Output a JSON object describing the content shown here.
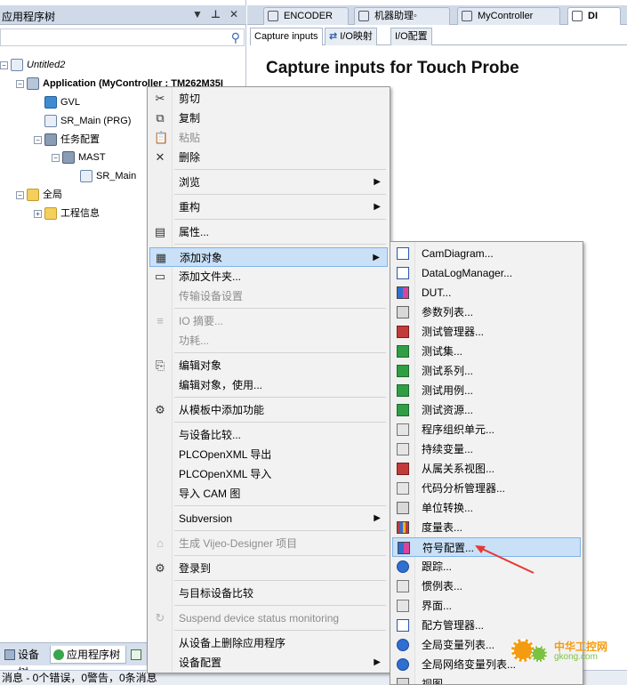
{
  "left_panel": {
    "title": "应用程序树",
    "controls": [
      "▼",
      "⊥",
      "✕"
    ],
    "tree": [
      {
        "label": "Untitled2",
        "level": 0,
        "icon": "document-icon",
        "expander": "−"
      },
      {
        "label": "Application (MyController : TM262M35I",
        "level": 1,
        "icon": "gear-icon",
        "expander": "−",
        "bold": true
      },
      {
        "label": "GVL",
        "level": 2,
        "icon": "globe-icon",
        "expander": ""
      },
      {
        "label": "SR_Main (PRG)",
        "level": 2,
        "icon": "program-icon",
        "expander": ""
      },
      {
        "label": "任务配置",
        "level": 2,
        "icon": "task-config-icon",
        "expander": "−"
      },
      {
        "label": "MAST",
        "level": 3,
        "icon": "task-icon",
        "expander": "−"
      },
      {
        "label": "SR_Main",
        "level": 4,
        "icon": "program-icon",
        "expander": ""
      },
      {
        "label": "全局",
        "level": 1,
        "icon": "folder-icon",
        "expander": "−"
      },
      {
        "label": "工程信息",
        "level": 2,
        "icon": "folder-icon",
        "expander": "+"
      }
    ],
    "bottom_tabs": [
      "设备树",
      "应用程序树"
    ]
  },
  "status": {
    "text": "消息 - 0个错误，0警告，0条消息"
  },
  "doc_tabs": [
    {
      "label": "ENCODER",
      "active": false
    },
    {
      "label": "机器助理◦",
      "active": false
    },
    {
      "label": "MyController",
      "active": false
    },
    {
      "label": "DI",
      "active": true
    }
  ],
  "sub_tabs": [
    {
      "label": "Capture inputs",
      "active": true
    },
    {
      "label": "I/O映射",
      "active": false
    },
    {
      "label": "I/O配置",
      "active": false
    }
  ],
  "page_heading": "Capture inputs for Touch Probe",
  "context_menu": {
    "items": [
      {
        "label": "剪切",
        "icon": "✂",
        "disabled": false,
        "submenu": false
      },
      {
        "label": "复制",
        "icon": "⧉",
        "disabled": false,
        "submenu": false
      },
      {
        "label": "粘贴",
        "icon": "📋",
        "disabled": true,
        "submenu": false
      },
      {
        "label": "删除",
        "icon": "✕",
        "disabled": false,
        "submenu": false
      },
      {
        "sep": true
      },
      {
        "label": "浏览",
        "icon": "",
        "disabled": false,
        "submenu": true
      },
      {
        "sep": true
      },
      {
        "label": "重构",
        "icon": "",
        "disabled": false,
        "submenu": true
      },
      {
        "sep": true
      },
      {
        "label": "属性...",
        "icon": "▤",
        "disabled": false,
        "submenu": false
      },
      {
        "sep": true
      },
      {
        "label": "添加对象",
        "icon": "▦",
        "disabled": false,
        "submenu": true,
        "highlight": true
      },
      {
        "label": "添加文件夹...",
        "icon": "▭",
        "disabled": false,
        "submenu": false
      },
      {
        "label": "传输设备设置",
        "icon": "",
        "disabled": true,
        "submenu": false
      },
      {
        "sep": true
      },
      {
        "label": "IO 摘要...",
        "icon": "≡",
        "disabled": true,
        "submenu": false
      },
      {
        "label": "功耗...",
        "icon": "",
        "disabled": true,
        "submenu": false
      },
      {
        "sep": true
      },
      {
        "label": "编辑对象",
        "icon": "⎘",
        "disabled": false,
        "submenu": false
      },
      {
        "label": "编辑对象，使用...",
        "icon": "",
        "disabled": false,
        "submenu": false
      },
      {
        "sep": true
      },
      {
        "label": "从模板中添加功能",
        "icon": "⚙",
        "disabled": false,
        "submenu": false
      },
      {
        "sep": true
      },
      {
        "label": "与设备比较...",
        "icon": "",
        "disabled": false,
        "submenu": false
      },
      {
        "label": "PLCOpenXML 导出",
        "icon": "",
        "disabled": false,
        "submenu": false
      },
      {
        "label": "PLCOpenXML 导入",
        "icon": "",
        "disabled": false,
        "submenu": false
      },
      {
        "label": "导入 CAM 图",
        "icon": "",
        "disabled": false,
        "submenu": false
      },
      {
        "sep": true
      },
      {
        "label": "Subversion",
        "icon": "",
        "disabled": false,
        "submenu": true
      },
      {
        "sep": true
      },
      {
        "label": "生成 Vijeo-Designer 项目",
        "icon": "⌂",
        "disabled": true,
        "submenu": false
      },
      {
        "sep": true
      },
      {
        "label": "登录到",
        "icon": "⚙",
        "disabled": false,
        "submenu": false
      },
      {
        "sep": true
      },
      {
        "label": "与目标设备比较",
        "icon": "",
        "disabled": false,
        "submenu": false
      },
      {
        "sep": true
      },
      {
        "label": "Suspend device status monitoring",
        "icon": "↻",
        "disabled": true,
        "submenu": false
      },
      {
        "sep": true
      },
      {
        "label": "从设备上删除应用程序",
        "icon": "",
        "disabled": false,
        "submenu": false
      },
      {
        "label": "设备配置",
        "icon": "",
        "disabled": false,
        "submenu": true
      }
    ]
  },
  "submenu": {
    "items": [
      {
        "label": "CamDiagram...",
        "icon": "c1"
      },
      {
        "label": "DataLogManager...",
        "icon": "c1"
      },
      {
        "label": "DUT...",
        "icon": "c6"
      },
      {
        "label": "参数列表...",
        "icon": "c2"
      },
      {
        "label": "测试管理器...",
        "icon": "c4"
      },
      {
        "label": "测试集...",
        "icon": "c3"
      },
      {
        "label": "测试系列...",
        "icon": "c3"
      },
      {
        "label": "测试用例...",
        "icon": "c3"
      },
      {
        "label": "测试资源...",
        "icon": "c3"
      },
      {
        "label": "程序组织单元...",
        "icon": "c7"
      },
      {
        "label": "持续变量...",
        "icon": "c7"
      },
      {
        "label": "从属关系视图...",
        "icon": "c4"
      },
      {
        "label": "代码分析管理器...",
        "icon": "c7"
      },
      {
        "label": "单位转换...",
        "icon": "c2"
      },
      {
        "label": "度量表...",
        "icon": "c8"
      },
      {
        "label": "符号配置...",
        "icon": "c6",
        "highlight": true
      },
      {
        "label": "跟踪...",
        "icon": "c5"
      },
      {
        "label": "惯例表...",
        "icon": "c7"
      },
      {
        "label": "界面...",
        "icon": "c7"
      },
      {
        "label": "配方管理器...",
        "icon": "c1"
      },
      {
        "label": "全局变量列表...",
        "icon": "c5"
      },
      {
        "label": "全局网络变量列表...",
        "icon": "c5"
      },
      {
        "label": "视图",
        "icon": "c2"
      }
    ]
  },
  "watermark": {
    "line1": "中华工控网",
    "line2": "gkong.com"
  },
  "colors": {
    "highlight": "#c9e0f7",
    "highlight_border": "#7eb4ea",
    "arrow": "#e53935"
  }
}
